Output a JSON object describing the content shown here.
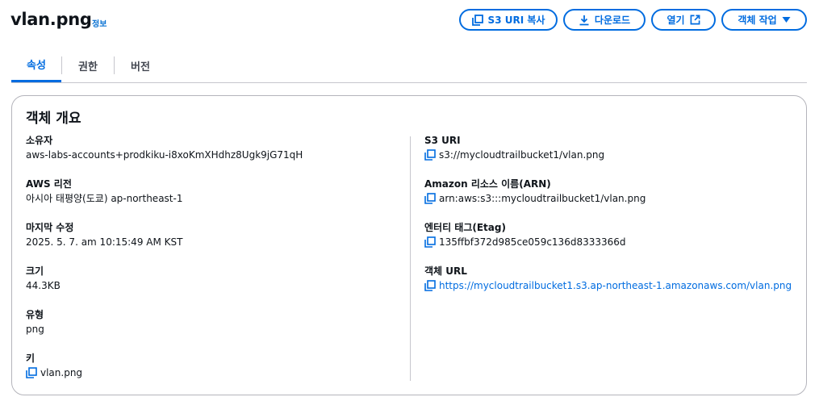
{
  "header": {
    "title": "vlan.png",
    "info_label": "정보"
  },
  "actions": {
    "copy_s3_uri": "S3 URI 복사",
    "download": "다운로드",
    "open": "열기",
    "object_actions": "객체 작업"
  },
  "tabs": [
    {
      "label": "속성",
      "active": true
    },
    {
      "label": "권한",
      "active": false
    },
    {
      "label": "버전",
      "active": false
    }
  ],
  "overview": {
    "title": "객체 개요",
    "left": [
      {
        "label": "소유자",
        "value": "aws-labs-accounts+prodkiku-i8xoKmXHdhz8Ugk9jG71qH"
      },
      {
        "label": "AWS 리전",
        "value": "아시아 태평양(도쿄) ap-northeast-1"
      },
      {
        "label": "마지막 수정",
        "value": "2025. 5. 7. am 10:15:49 AM KST"
      },
      {
        "label": "크기",
        "value": "44.3KB"
      },
      {
        "label": "유형",
        "value": "png"
      },
      {
        "label": "키",
        "value": "vlan.png"
      }
    ],
    "right": [
      {
        "label": "S3 URI",
        "value": "s3://mycloudtrailbucket1/vlan.png"
      },
      {
        "label": "Amazon 리소스 이름(ARN)",
        "value": "arn:aws:s3:::mycloudtrailbucket1/vlan.png"
      },
      {
        "label": "엔터티 태그(Etag)",
        "value": "135ffbf372d985ce059c136d8333366d"
      },
      {
        "label": "객체 URL",
        "value": "https://mycloudtrailbucket1.s3.ap-northeast-1.amazonaws.com/vlan.png"
      }
    ]
  },
  "colors": {
    "accent": "#006ce0",
    "text": "#0f141a",
    "border": "#b4b4bb"
  }
}
